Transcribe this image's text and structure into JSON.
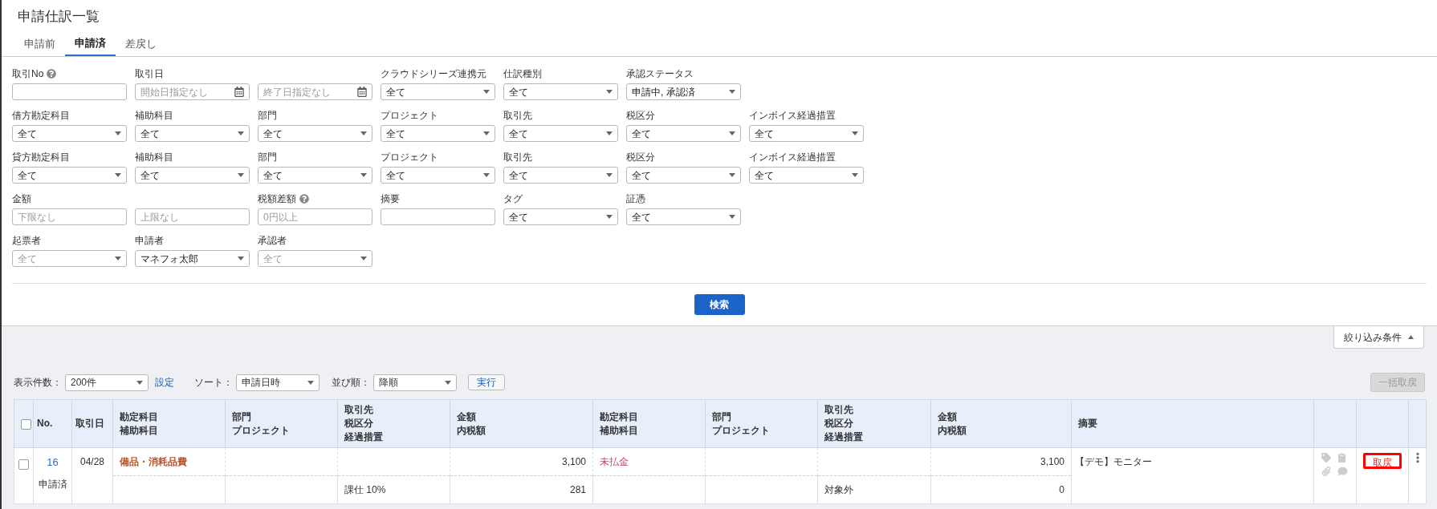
{
  "title": "申請仕訳一覧",
  "tabs": [
    {
      "label": "申請前",
      "selected": false
    },
    {
      "label": "申請済",
      "selected": true
    },
    {
      "label": "差戻し",
      "selected": false
    }
  ],
  "filters": [
    [
      {
        "label": "取引No",
        "help": true,
        "kind": "text"
      },
      {
        "label": "取引日",
        "kind": "date",
        "placeholder": "開始日指定なし"
      },
      {
        "kind": "date",
        "placeholder": "終了日指定なし"
      },
      {
        "label": "クラウドシリーズ連携元",
        "kind": "select",
        "value": "全て"
      },
      {
        "label": "仕訳種別",
        "kind": "select",
        "value": "全て"
      },
      {
        "label": "承認ステータス",
        "kind": "select",
        "value": "申請中, 承認済"
      }
    ],
    [
      {
        "label": "借方勘定科目",
        "kind": "select",
        "value": "全て"
      },
      {
        "label": "補助科目",
        "kind": "select",
        "value": "全て"
      },
      {
        "label": "部門",
        "kind": "select",
        "value": "全て"
      },
      {
        "label": "プロジェクト",
        "kind": "select",
        "value": "全て"
      },
      {
        "label": "取引先",
        "kind": "select",
        "value": "全て"
      },
      {
        "label": "税区分",
        "kind": "select",
        "value": "全て"
      },
      {
        "label": "インボイス経過措置",
        "kind": "select",
        "value": "全て"
      }
    ],
    [
      {
        "label": "貸方勘定科目",
        "kind": "select",
        "value": "全て"
      },
      {
        "label": "補助科目",
        "kind": "select",
        "value": "全て"
      },
      {
        "label": "部門",
        "kind": "select",
        "value": "全て"
      },
      {
        "label": "プロジェクト",
        "kind": "select",
        "value": "全て"
      },
      {
        "label": "取引先",
        "kind": "select",
        "value": "全て"
      },
      {
        "label": "税区分",
        "kind": "select",
        "value": "全て"
      },
      {
        "label": "インボイス経過措置",
        "kind": "select",
        "value": "全て"
      }
    ],
    [
      {
        "label": "金額",
        "kind": "text",
        "placeholder": "下限なし"
      },
      {
        "kind": "text",
        "placeholder": "上限なし"
      },
      {
        "label": "税額差額",
        "help": true,
        "kind": "text",
        "placeholder": "0円以上"
      },
      {
        "label": "摘要",
        "kind": "text"
      },
      {
        "label": "タグ",
        "kind": "select",
        "value": "全て"
      },
      {
        "label": "証憑",
        "kind": "select",
        "value": "全て"
      }
    ],
    [
      {
        "label": "起票者",
        "kind": "select",
        "value": "全て",
        "disabled": true
      },
      {
        "label": "申請者",
        "kind": "select",
        "value": "マネフォ太郎",
        "disabled": false
      },
      {
        "label": "承認者",
        "kind": "select",
        "value": "全て",
        "disabled": true
      }
    ]
  ],
  "search_button": "検索",
  "filter_toggle": "絞り込み条件",
  "toolbar": {
    "per_page_label": "表示件数：",
    "per_page": "200件",
    "settings_link": "設定",
    "sort_label": "ソート：",
    "sort": "申請日時",
    "order_label": "並び順：",
    "order": "降順",
    "run_button": "実行",
    "bulk_button": {
      "label": "一括取戻",
      "disabled": true
    }
  },
  "table": {
    "header_checked": false,
    "columns": [
      [
        "No."
      ],
      [
        "取引日"
      ],
      [
        "勘定科目",
        "補助科目"
      ],
      [
        "部門",
        "プロジェクト"
      ],
      [
        "取引先",
        "税区分",
        "経過措置"
      ],
      [
        "金額",
        "内税額"
      ],
      [
        "勘定科目",
        "補助科目"
      ],
      [
        "部門",
        "プロジェクト"
      ],
      [
        "取引先",
        "税区分",
        "経過措置"
      ],
      [
        "金額",
        "内税額"
      ],
      [
        "摘要"
      ]
    ],
    "rows": [
      {
        "checked": false,
        "no": "16",
        "status": "申請済",
        "date": "04/28",
        "debit": {
          "account": "備品・消耗品費",
          "color": "#b5532a",
          "amount": "3,100",
          "tax": "課仕 10%",
          "tax_amount": "281"
        },
        "credit": {
          "account": "未払金",
          "color": "#c2416b",
          "amount": "3,100",
          "tax": "対象外",
          "tax_amount": "0"
        },
        "memo": "【デモ】モニター",
        "action": "取戻",
        "highlighted": true
      }
    ]
  }
}
